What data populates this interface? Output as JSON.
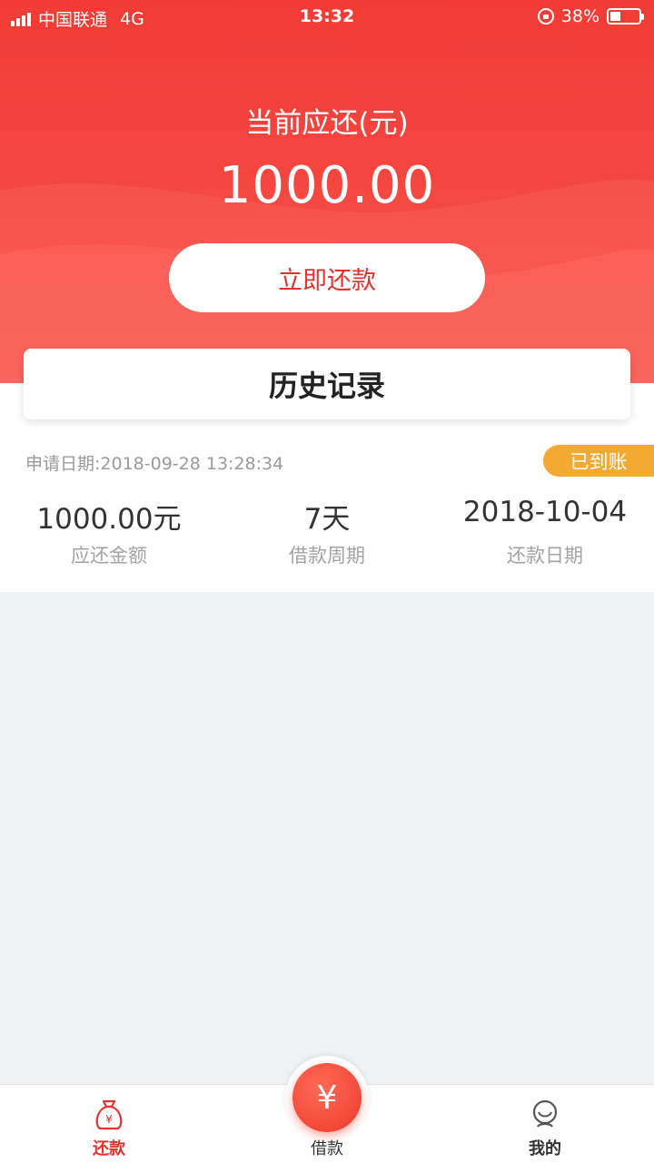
{
  "status_bar": {
    "carrier": "中国联通",
    "network": "4G",
    "time": "13:32",
    "battery": "38%",
    "battery_level": 0.38
  },
  "header": {
    "due_label": "当前应还(元)",
    "due_amount": "1000.00",
    "repay_button": "立即还款"
  },
  "history": {
    "title": "历史记录"
  },
  "record": {
    "apply_date": "申请日期:2018-09-28 13:28:34",
    "status": "已到账",
    "amount_value": "1000.00元",
    "amount_label": "应还金额",
    "period_value": "7天",
    "period_label": "借款周期",
    "due_date_value": "2018-10-04",
    "due_date_label": "还款日期"
  },
  "tabbar": {
    "repay": "还款",
    "borrow": "借款",
    "mine": "我的",
    "borrow_symbol": "¥",
    "active_color": "#e0332e",
    "inactive_color": "#333333"
  },
  "colors": {
    "brand_red": "#f23b35",
    "badge_orange": "#f5a935"
  }
}
